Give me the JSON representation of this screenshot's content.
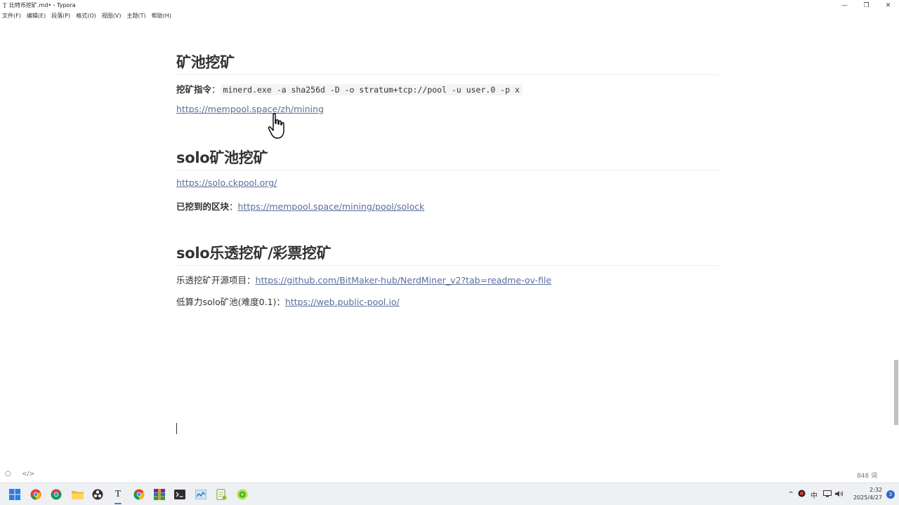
{
  "window": {
    "app_glyph": "T",
    "title": "比特币挖矿.md• - Typora",
    "minimize": "—",
    "maximize": "❐",
    "close": "✕"
  },
  "menu": [
    "文件(F)",
    "编辑(E)",
    "段落(P)",
    "格式(O)",
    "视图(V)",
    "主题(T)",
    "帮助(H)"
  ],
  "doc": {
    "h1": "矿池挖矿",
    "cmd_label": "挖矿指令",
    "sep": "：",
    "cmd_code": "minerd.exe -a sha256d -D -o stratum+tcp://pool -u user.0 -p x",
    "link1": "https://mempool.space/zh/mining",
    "h2": "solo矿池挖矿",
    "link2": "https://solo.ckpool.org/",
    "blocks_label": "已挖到的区块",
    "link3": "https://mempool.space/mining/pool/solock",
    "h3": "solo乐透挖矿/彩票挖矿",
    "lotto_label": "乐透挖矿开源项目",
    "link4": "https://github.com/BitMaker-hub/NerdMiner_v2?tab=readme-ov-file",
    "lowpow_label": "低算力solo矿池(难度0.1)",
    "link5": "https://web.public-pool.io/"
  },
  "status": {
    "word_count": "848 词",
    "outline_icon": "○",
    "source_icon": "</>"
  },
  "taskbar": {
    "tray_up": "^",
    "ime": "中",
    "time": "2:32",
    "date": "2025/4/27",
    "notifications": "3"
  },
  "colors": {
    "link": "#5a6e9a",
    "heading": "#333333",
    "taskbar_bg": "#eef0f4"
  }
}
